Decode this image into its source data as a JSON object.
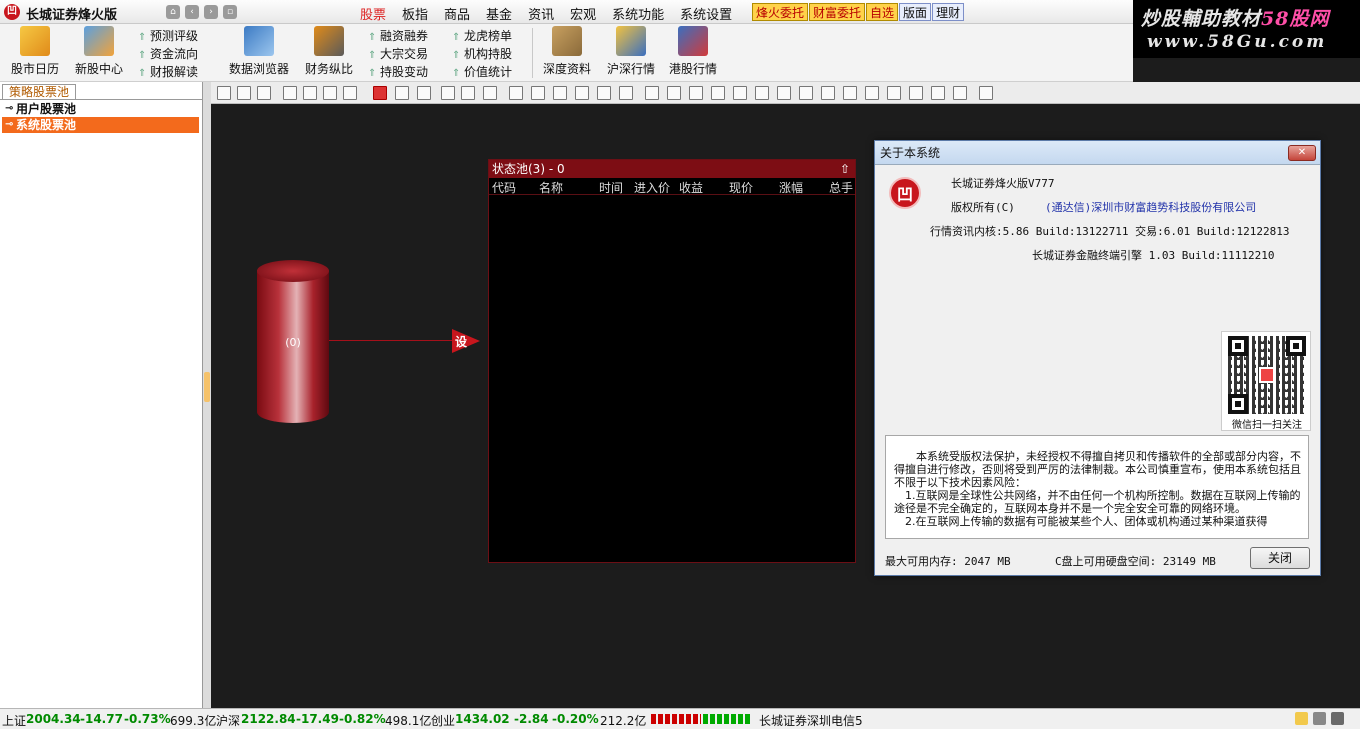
{
  "app": {
    "title": "长城证券烽火版",
    "logo_glyph": "凹",
    "nav_glyphs": [
      "⌂",
      "‹",
      "›",
      "▫"
    ]
  },
  "menu": [
    "股票",
    "板指",
    "商品",
    "基金",
    "资讯",
    "宏观",
    "系统功能",
    "系统设置"
  ],
  "menu_active": "股票",
  "quick_tabs": [
    {
      "label": "烽火委托",
      "style": "gold"
    },
    {
      "label": "财富委托",
      "style": "gold"
    },
    {
      "label": "自选",
      "style": "gold"
    },
    {
      "label": "版面",
      "style": "blue"
    },
    {
      "label": "理财",
      "style": "blue"
    }
  ],
  "watermark": {
    "line1_main": "炒股輔助教材",
    "line1_accent": "58股网",
    "line2": "www.58Gu.com"
  },
  "toolbar": {
    "big": [
      {
        "label": "股市日历",
        "icon": "calendar-icon"
      },
      {
        "label": "新股中心",
        "icon": "new-stock-icon"
      },
      {
        "label": "数据浏览器",
        "icon": "data-browser-icon"
      },
      {
        "label": "财务纵比",
        "icon": "finance-compare-icon"
      },
      {
        "label": "深度资料",
        "icon": "deep-info-icon"
      },
      {
        "label": "沪深行情",
        "icon": "sh-sz-quotes-icon"
      },
      {
        "label": "港股行情",
        "icon": "hk-quotes-icon"
      }
    ],
    "small": [
      [
        "预测评级",
        "资金流向",
        "财报解读"
      ],
      [
        "融资融券",
        "大宗交易",
        "持股变动"
      ],
      [
        "龙虎榜单",
        "机构持股",
        "价值统计"
      ]
    ]
  },
  "left_panel": {
    "tab": "策略股票池",
    "items": [
      {
        "label": "用户股票池",
        "selected": false
      },
      {
        "label": "系统股票池",
        "selected": true
      }
    ]
  },
  "canvas": {
    "cylinder_label": "(0)",
    "set_button": "设",
    "status_pool": {
      "title": "状态池(3) - 0",
      "collapse_glyph": "⇧",
      "columns": [
        "代码",
        "名称",
        "时间",
        "进入价",
        "收益",
        "现价",
        "涨幅",
        "总手"
      ]
    }
  },
  "about": {
    "title": "关于本系统",
    "close_glyph": "✕",
    "product": "长城证券烽火版V777",
    "copyright_label": "版权所有(C)",
    "copyright_owner": "(通达信)深圳市财富趋势科技股份有限公司",
    "core_version": "行情资讯内核:5.86 Build:13122711 交易:6.01 Build:12122813",
    "engine_version": "长城证券金融终端引擎 1.03 Build:11112210",
    "qr_caption": "微信扫一扫关注",
    "license": [
      "本系统受版权法保护，未经授权不得擅自拷贝和传播软件的全部或部分内容，不得擅自进行修改，否则将受到严厉的法律制裁。本公司慎重宣布，使用本系统包括且不限于以下技术因素风险：",
      "1.互联网是全球性公共网络，并不由任何一个机构所控制。数据在互联网上传输的途径是不完全确定的，互联网本身并不是一个完全安全可靠的网络环境。",
      "2.在互联网上传输的数据有可能被某些个人、团体或机构通过某种渠道获得"
    ],
    "memory": "最大可用内存: 2047 MB",
    "disk": "C盘上可用硬盘空间: 23149 MB",
    "ok_button": "关闭"
  },
  "statusbar": {
    "sh": {
      "label": "上证",
      "value": "2004.34",
      "change": "-14.77",
      "pct": "-0.73%",
      "amount": "699.3亿"
    },
    "hs": {
      "label": "沪深",
      "value": "2122.84",
      "change": "-17.49",
      "pct": "-0.82%",
      "amount": "498.1亿"
    },
    "cy": {
      "label": "创业",
      "value": "1434.02",
      "change": "-2.84",
      "pct": "-0.20%",
      "amount": "212.2亿"
    },
    "server": "长城证券深圳电信5",
    "colors": {
      "down": "#008a00",
      "up": "#cc0000"
    }
  }
}
